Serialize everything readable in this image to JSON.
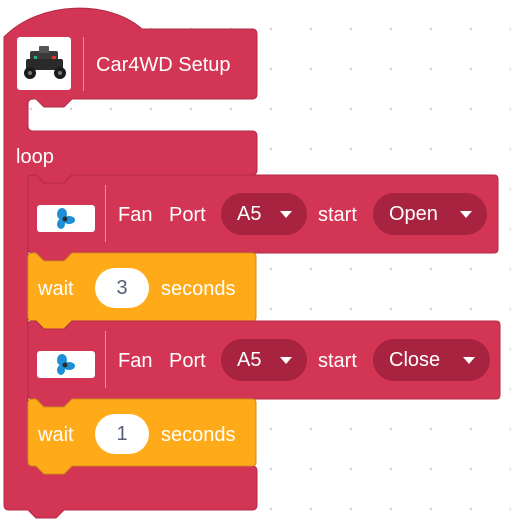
{
  "colors": {
    "robot_block": "#d33655",
    "robot_block_border": "#b02a46",
    "dropdown_fill": "#a8233f",
    "control_block": "#ffab19",
    "control_block_border": "#cf8b17",
    "input_text": "#575e75"
  },
  "setup_block": {
    "icon": "robot-car-icon",
    "label": "Car4WD Setup"
  },
  "loop_block": {
    "label": "loop"
  },
  "fan_blocks": [
    {
      "icon": "fan-icon",
      "label_fan": "Fan",
      "label_port": "Port",
      "port_value": "A5",
      "label_start": "start",
      "state_value": "Open"
    },
    {
      "icon": "fan-icon",
      "label_fan": "Fan",
      "label_port": "Port",
      "port_value": "A5",
      "label_start": "start",
      "state_value": "Close"
    }
  ],
  "wait_blocks": [
    {
      "label_wait": "wait",
      "value": "3",
      "label_unit": "seconds"
    },
    {
      "label_wait": "wait",
      "value": "1",
      "label_unit": "seconds"
    }
  ]
}
